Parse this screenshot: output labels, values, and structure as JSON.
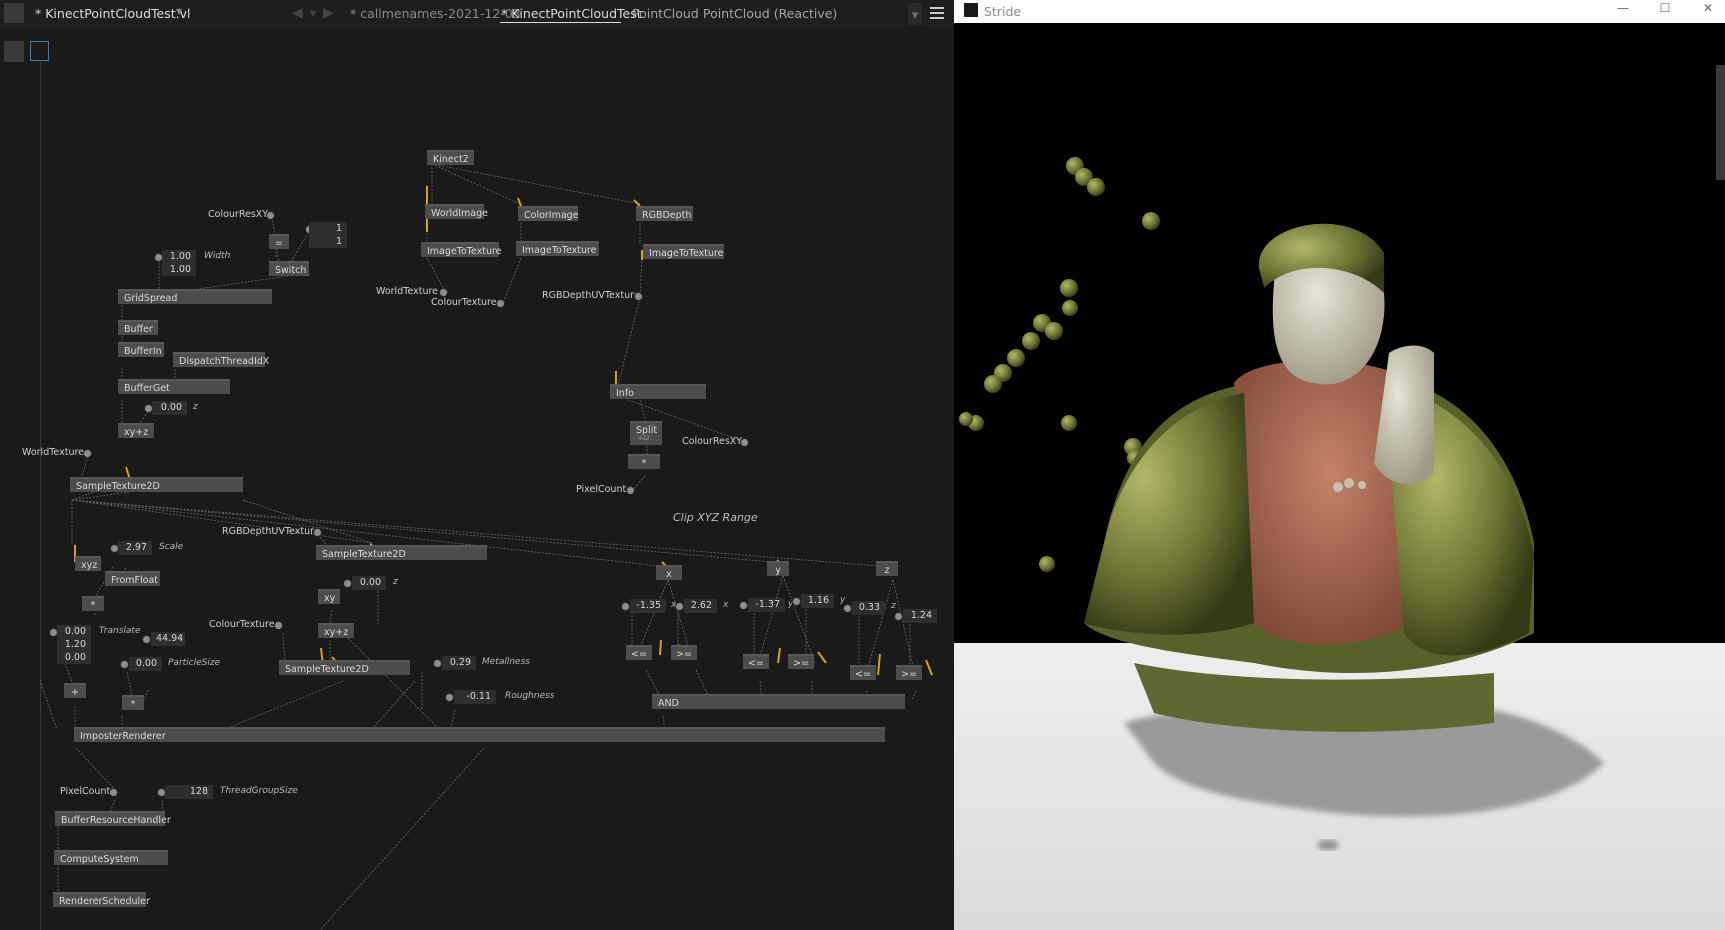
{
  "editor": {
    "doc_title": "* KinectPointCloudTest.vl",
    "tabs": [
      {
        "label": "* callmenames-2021-12-03"
      },
      {
        "label": "* KinectPointCloudTest"
      },
      {
        "label": "PointCloud"
      },
      {
        "label": "PointCloud (Reactive)"
      }
    ],
    "nodes": {
      "kinect2": "Kinect2",
      "world_image": "WorldImage",
      "color_image": "ColorImage",
      "rgb_depth": "RGBDepth",
      "image_to_texture_1": "ImageToTexture",
      "image_to_texture_2": "ImageToTexture",
      "image_to_texture_3": "ImageToTexture",
      "eq": "=",
      "switch": "Switch",
      "grid_spread": "GridSpread",
      "buffer": "Buffer",
      "buffer_in": "BufferIn",
      "dispatch_thread_idx": "DispatchThreadIdX",
      "buffer_get": "BufferGet",
      "xyz_plus": "xy+z",
      "info": "Info",
      "split": "Split",
      "split_sub": "int2",
      "mul_info": "*",
      "sample_texture_1": "SampleTexture2D",
      "sample_texture_2": "SampleTexture2D",
      "sample_texture_3": "SampleTexture2D",
      "xyz": "xyz",
      "from_float": "FromFloat",
      "mul_scale": "*",
      "xy": "xy",
      "xyz_plus_2": "xy+z",
      "plus": "+",
      "mul_particle": "*",
      "x": "x",
      "y": "y",
      "z": "z",
      "lte_x": "<=",
      "gte_x": ">=",
      "lte_y": "<=",
      "gte_y": ">=",
      "lte_z": "<=",
      "gte_z": ">=",
      "and": "AND",
      "imposter_renderer": "ImposterRenderer",
      "buffer_resource_handler": "BufferResourceHandler",
      "compute_system": "ComputeSystem",
      "renderer_scheduler": "RendererScheduler"
    },
    "pads": {
      "colour_res_xy": "ColourResXY",
      "colour_res_xy_2": "ColourResXY",
      "world_texture": "WorldTexture",
      "colour_texture": "ColourTexture",
      "rgb_depth_uv_texture": "RGBDepthUVTexture",
      "world_texture_2": "WorldTexture",
      "rgb_depth_uv_texture_2": "RGBDepthUVTexture",
      "colour_texture_2": "ColourTexture",
      "pixel_count": "PixelCount",
      "pixel_count_2": "PixelCount"
    },
    "values": {
      "switch_a": "1",
      "switch_b": "1",
      "width_1": "1.00",
      "width_2": "1.00",
      "z_offset": "0.00",
      "scale": "2.97",
      "translate_1": "0.00",
      "translate_2": "1.20",
      "translate_3": "0.00",
      "particle_size_mul": "44.94",
      "particle_size": "0.00",
      "z_2": "0.00",
      "metallness": "0.29",
      "roughness": "-0.11",
      "x_min": "-1.35",
      "x_max": "2.62",
      "y_min": "-1.37",
      "y_max": "1.16",
      "z_min": "0.33",
      "z_max": "1.24",
      "thread_group_size": "128"
    },
    "labels": {
      "width": "Width",
      "z": "z",
      "scale": "Scale",
      "translate": "Translate",
      "particle_size": "ParticleSize",
      "z_2": "z",
      "metallness": "Metallness",
      "roughness": "Roughness",
      "x": "x",
      "y": "y",
      "z_3": "z",
      "thread_group_size": "ThreadGroupSize"
    },
    "comment": "Clip XYZ Range"
  },
  "stride": {
    "title": "Stride",
    "minimize": "—",
    "maximize": "☐",
    "close": "✕"
  },
  "colors": {
    "editor_bg": "#1a1a1a",
    "node_bg": "#4c4c4c",
    "iobox_bg": "#2e2e2e",
    "link_orange": "#d8a020",
    "stride_floor": "#e2e2e2"
  }
}
